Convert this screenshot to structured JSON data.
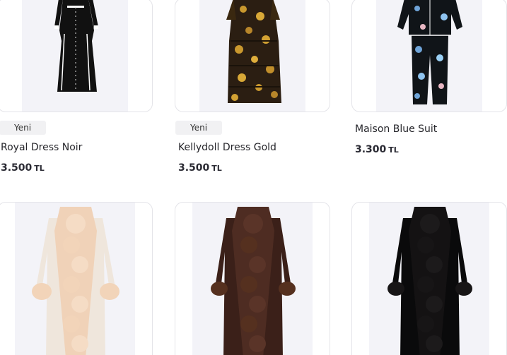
{
  "products_row1": [
    {
      "badge": "Yeni",
      "name": "Royal Dress Noir",
      "price": "3.500",
      "currency": "TL",
      "image_icon": "black-dress-image"
    },
    {
      "badge": "Yeni",
      "name": "Kellydoll Dress Gold",
      "price": "3.500",
      "currency": "TL",
      "image_icon": "gold-floral-dress-image"
    },
    {
      "badge": "",
      "name": "Maison Blue Suit",
      "price": "3.300",
      "currency": "TL",
      "image_icon": "blue-floral-suit-image"
    }
  ],
  "products_row2": [
    {
      "image_icon": "cream-fur-coat-image",
      "color": "#eadccf"
    },
    {
      "image_icon": "brown-fur-coat-image",
      "color": "#4a2a22"
    },
    {
      "image_icon": "black-fur-coat-image",
      "color": "#0d0b0c"
    }
  ],
  "colors": {
    "card_border": "#e4e4e9",
    "badge_bg": "#f1f1f3",
    "photo_bg": "#f3f3f8"
  }
}
